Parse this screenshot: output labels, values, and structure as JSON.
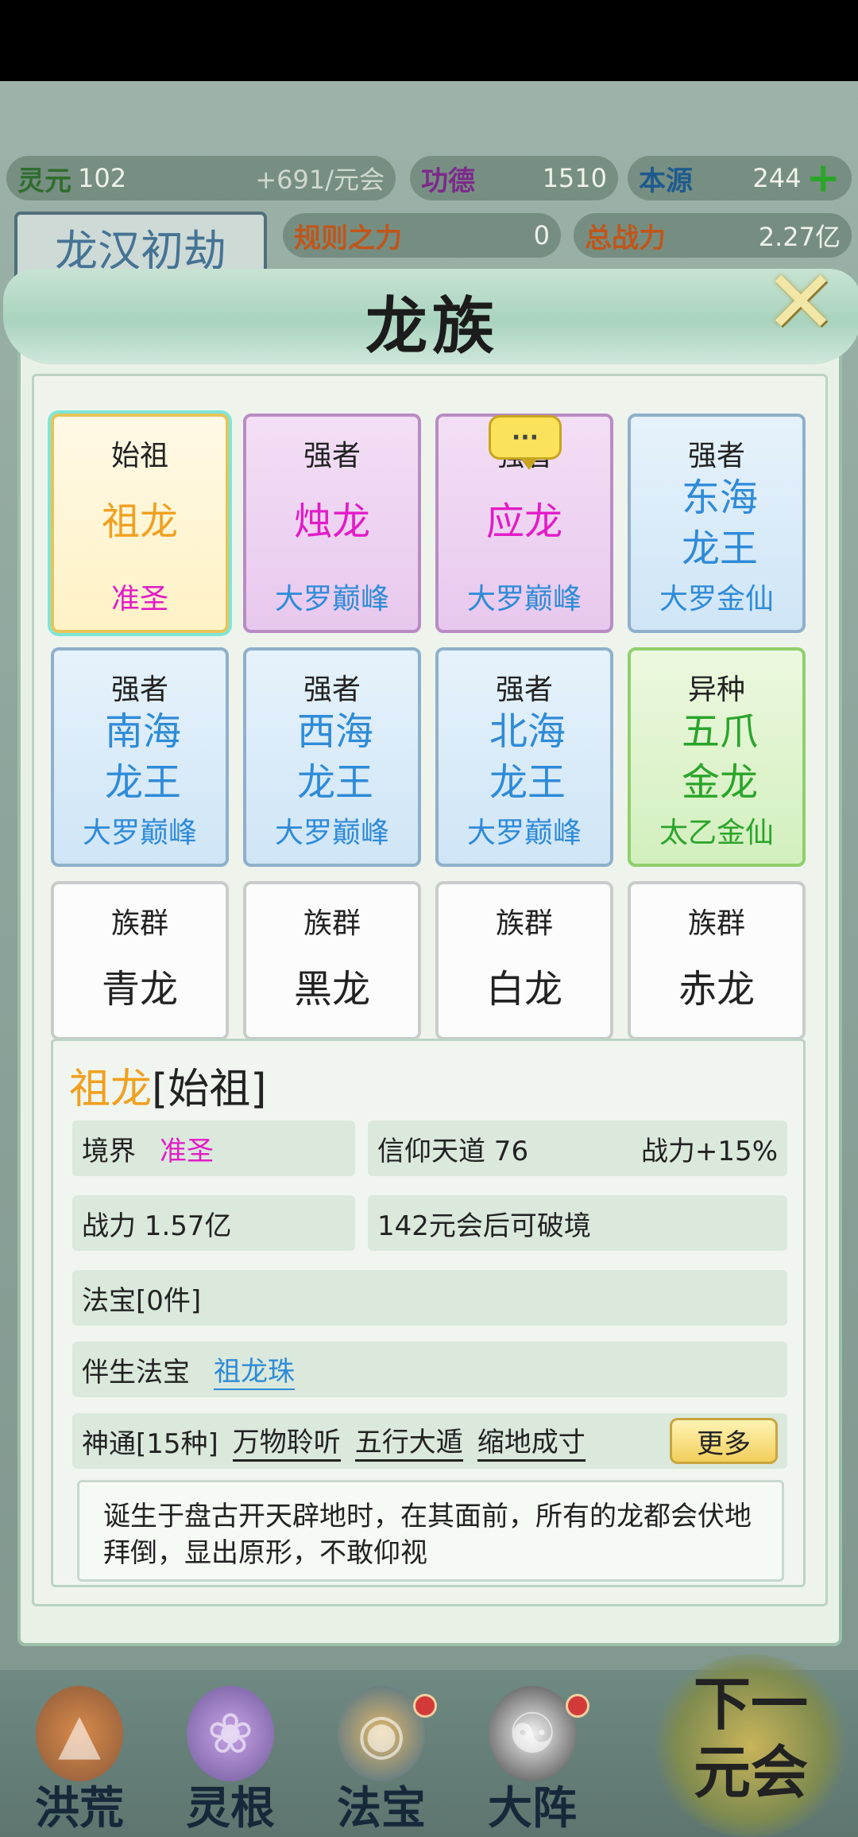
{
  "resources": {
    "lingyuan_label": "灵元",
    "lingyuan_value": "102",
    "lingyuan_rate": "+691/元会",
    "gongde_label": "功德",
    "gongde_value": "1510",
    "benyuan_label": "本源",
    "benyuan_value": "244",
    "plus_symbol": "+",
    "guize_label": "规则之力",
    "guize_value": "0",
    "zhanli_label": "总战力",
    "zhanli_value": "2.27亿"
  },
  "era": "龙汉初劫",
  "modal": {
    "title": "龙族",
    "close_symbol": "✕"
  },
  "cards": [
    {
      "role": "始祖",
      "name": "祖龙",
      "rank": "准圣"
    },
    {
      "role": "强者",
      "name": "烛龙",
      "rank": "大罗巅峰"
    },
    {
      "role": "强者",
      "name": "应龙",
      "rank": "大罗巅峰"
    },
    {
      "role": "强者",
      "name": "东海龙王",
      "rank": "大罗金仙"
    },
    {
      "role": "强者",
      "name": "南海龙王",
      "rank": "大罗巅峰"
    },
    {
      "role": "强者",
      "name": "西海龙王",
      "rank": "大罗巅峰"
    },
    {
      "role": "强者",
      "name": "北海龙王",
      "rank": "大罗巅峰"
    },
    {
      "role": "异种",
      "name": "五爪金龙",
      "rank": "太乙金仙"
    },
    {
      "role": "族群",
      "name": "青龙",
      "rank": ""
    },
    {
      "role": "族群",
      "name": "黑龙",
      "rank": ""
    },
    {
      "role": "族群",
      "name": "白龙",
      "rank": ""
    },
    {
      "role": "族群",
      "name": "赤龙",
      "rank": ""
    }
  ],
  "chat_bubble": "···",
  "detail": {
    "title_name": "祖龙",
    "title_role": "[始祖]",
    "realm_label": "境界",
    "realm_value": "准圣",
    "faith": "信仰天道  76",
    "faith_bonus": "战力+15%",
    "power": "战力 1.57亿",
    "breakthrough": "142元会后可破境",
    "treasures": "法宝[0件]",
    "companion_label": "伴生法宝",
    "companion_value": "祖龙珠",
    "skills_label": "神通[15种]",
    "skills": [
      "万物聆听",
      "五行大遁",
      "缩地成寸"
    ],
    "more_label": "更多",
    "description": "诞生于盘古开天辟地时，在其面前，所有的龙都会伏地拜倒，显出原形，不敢仰视"
  },
  "nav": [
    {
      "label": "洪荒",
      "icon": "mountain-icon"
    },
    {
      "label": "灵根",
      "icon": "lotus-icon"
    },
    {
      "label": "法宝",
      "icon": "treasure-icon"
    },
    {
      "label": "大阵",
      "icon": "taiji-icon"
    }
  ],
  "next_button": {
    "line1": "下一",
    "line2": "元会"
  }
}
